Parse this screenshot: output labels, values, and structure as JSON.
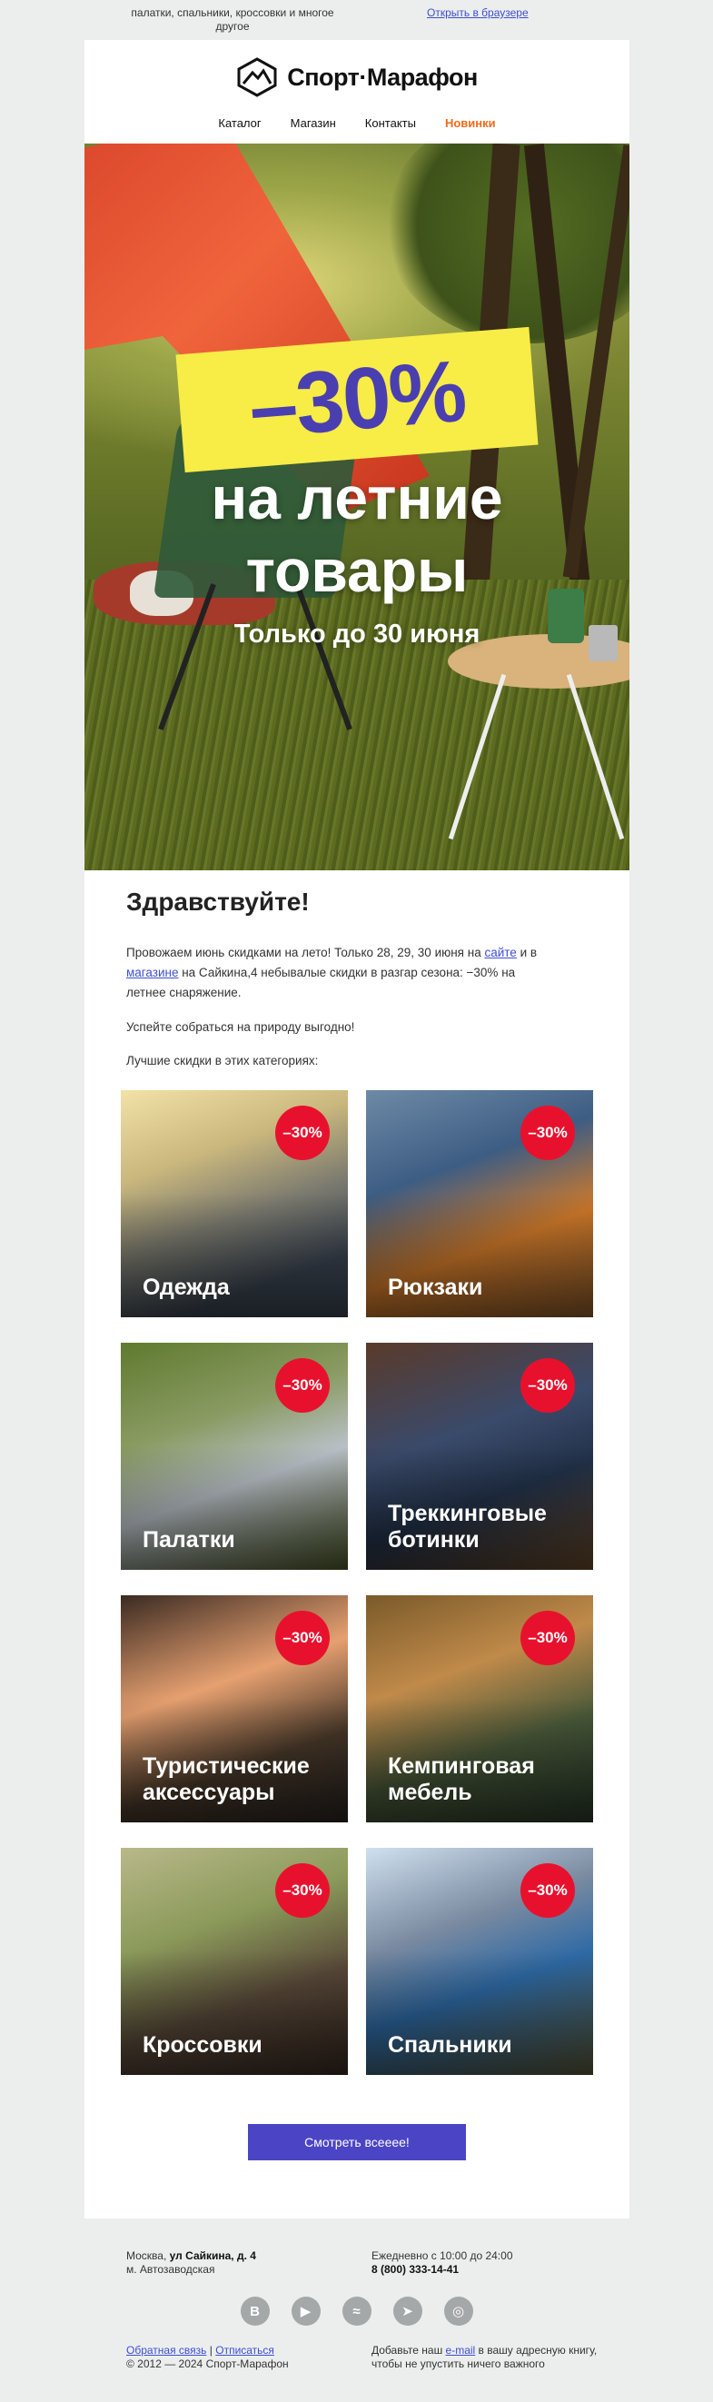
{
  "preheader": {
    "text": "палатки, спальники, кроссовки и многое другое",
    "browser_link": "Открыть в браузере"
  },
  "header": {
    "logo_text": "Спорт·Марафон",
    "nav": [
      {
        "label": "Каталог"
      },
      {
        "label": "Магазин"
      },
      {
        "label": "Контакты"
      },
      {
        "label": "Новинки"
      }
    ]
  },
  "hero": {
    "discount": "–30%",
    "line1": "на летние",
    "line2": "товары",
    "line3": "Только до 30 июня"
  },
  "body": {
    "greeting": "Здравствуйте!",
    "p1_a": "Провожаем июнь скидками на лето! Только 28, 29, 30 июня на ",
    "p1_link1": "сайте",
    "p1_b": " и в ",
    "p1_link2": "магазине",
    "p1_c": " на Сайкина,4 небывалые скидки в разгар сезона: −30% на летнее снаряжение.",
    "p2": "Успейте собраться на природу выгодно!",
    "p3": "Лучшие скидки в этих категориях:"
  },
  "categories": [
    {
      "title": "Одежда",
      "badge": "–30%"
    },
    {
      "title": "Рюкзаки",
      "badge": "–30%"
    },
    {
      "title": "Палатки",
      "badge": "–30%"
    },
    {
      "title": "Треккинговые ботинки",
      "badge": "–30%"
    },
    {
      "title": "Туристические аксессуары",
      "badge": "–30%"
    },
    {
      "title": "Кемпинговая мебель",
      "badge": "–30%"
    },
    {
      "title": "Кроссовки",
      "badge": "–30%"
    },
    {
      "title": "Спальники",
      "badge": "–30%"
    }
  ],
  "cta": {
    "label": "Смотреть всееее!"
  },
  "footer": {
    "city": "Москва,",
    "street": "ул Сайкина, д. 4",
    "metro": "м. Автозаводская",
    "hours": "Ежедневно с 10:00 до 24:00",
    "phone": "8 (800) 333-14-41",
    "socials": [
      {
        "icon": "vk-icon",
        "glyph": "В"
      },
      {
        "icon": "youtube-icon",
        "glyph": "▶"
      },
      {
        "icon": "wave-icon",
        "glyph": "≈"
      },
      {
        "icon": "telegram-icon",
        "glyph": "➤"
      },
      {
        "icon": "odnoklassniki-icon",
        "glyph": "◎"
      }
    ],
    "feedback_link": "Обратная связь",
    "separator": "|",
    "unsubscribe_link": "Отписаться",
    "copyright": "© 2012 — 2024 Спорт-Марафон",
    "addbook_a": "Добавьте наш ",
    "addbook_link": "e-mail",
    "addbook_b": " в вашу адресную книгу, чтобы не упустить ничего важного"
  },
  "colors": {
    "accent_nav": "#f26a1b",
    "badge_red": "#e8112d",
    "cta_blue": "#4b45c6",
    "hero_yellow": "#f8ec46",
    "hero_purple": "#4a3fb0",
    "link_blue": "#3d4fcf"
  }
}
